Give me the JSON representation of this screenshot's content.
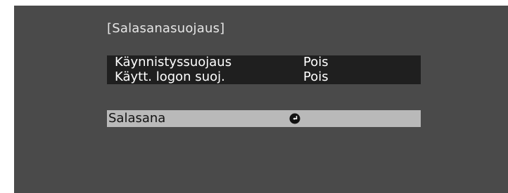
{
  "menu": {
    "title": "[Salasanasuojaus]",
    "items": [
      {
        "label": "Käynnistyssuojaus",
        "value": "Pois"
      },
      {
        "label": "Käytt. logon suoj.",
        "value": "Pois"
      }
    ],
    "selected_item": {
      "label": "Salasana",
      "icon": "enter-icon"
    }
  }
}
